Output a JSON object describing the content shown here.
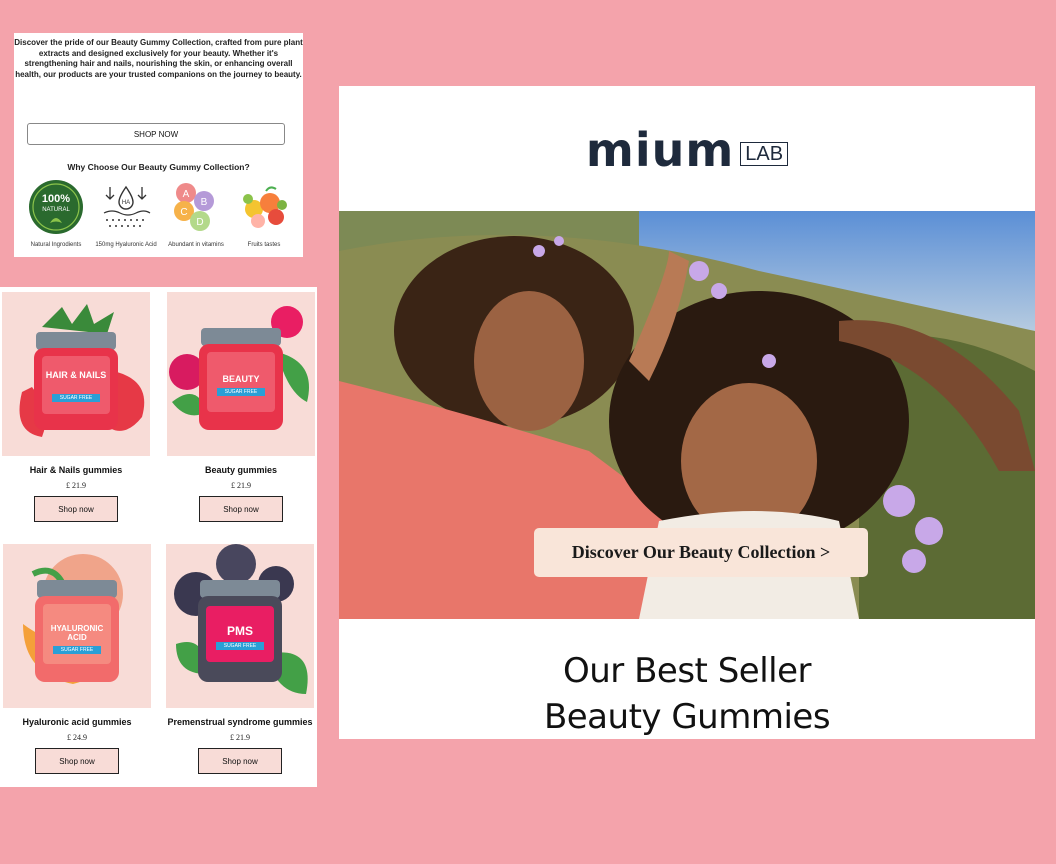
{
  "intro": {
    "text": "Discover the pride of our Beauty Gummy Collection, crafted from pure plant extracts and designed exclusively for your beauty. Whether it's strengthening hair and nails, nourishing the skin, or enhancing overall health, our products are your trusted companions on the journey to beauty.",
    "shop_now_label": "SHOP NOW",
    "why_heading": "Why Choose Our Beauty Gummy Collection?",
    "features": [
      {
        "label": "Natural Ingrodients",
        "icon": "natural-badge-icon",
        "badge_line1": "100%",
        "badge_line2": "NATURAL"
      },
      {
        "label": "150mg  Hyaluronic Acid",
        "icon": "hyaluronic-acid-icon",
        "badge_text": "HA"
      },
      {
        "label": "Abundant in vitamins",
        "icon": "vitamins-icon",
        "letters": [
          "A",
          "B",
          "C",
          "D"
        ]
      },
      {
        "label": "Fruits tastes",
        "icon": "fruits-icon"
      }
    ]
  },
  "products": [
    {
      "name": "Hair & Nails gummies",
      "price": "£ 21.9",
      "button": "Shop now",
      "jar_title": "HAIR & NAILS",
      "jar_tag": "SUGAR FREE",
      "brand": "mium lab"
    },
    {
      "name": "Beauty gummies",
      "price": "£ 21.9",
      "button": "Shop now",
      "jar_title": "BEAUTY",
      "jar_tag": "SUGAR FREE",
      "brand": "mium lab"
    },
    {
      "name": "Hyaluronic acid gummies",
      "price": "£ 24.9",
      "button": "Shop now",
      "jar_title": "HYALURONIC ACID",
      "jar_tag": "SUGAR FREE",
      "brand": "mium lab"
    },
    {
      "name": "Premenstrual syndrome gummies",
      "price": "£ 21.9",
      "button": "Shop now",
      "jar_title": "PMS",
      "jar_tag": "SUGAR FREE",
      "brand": "mium lab"
    }
  ],
  "email": {
    "logo_word": "mium",
    "logo_box": "LAB",
    "discover_button": "Discover Our Beauty Collection >",
    "best_seller_line1": "Our Best Seller",
    "best_seller_line2": "Beauty Gummies"
  },
  "colors": {
    "background": "#f4a3ab",
    "product_tile": "#f8dcd7",
    "logo": "#1e2a3c",
    "discover_button": "#f9e5d9"
  }
}
